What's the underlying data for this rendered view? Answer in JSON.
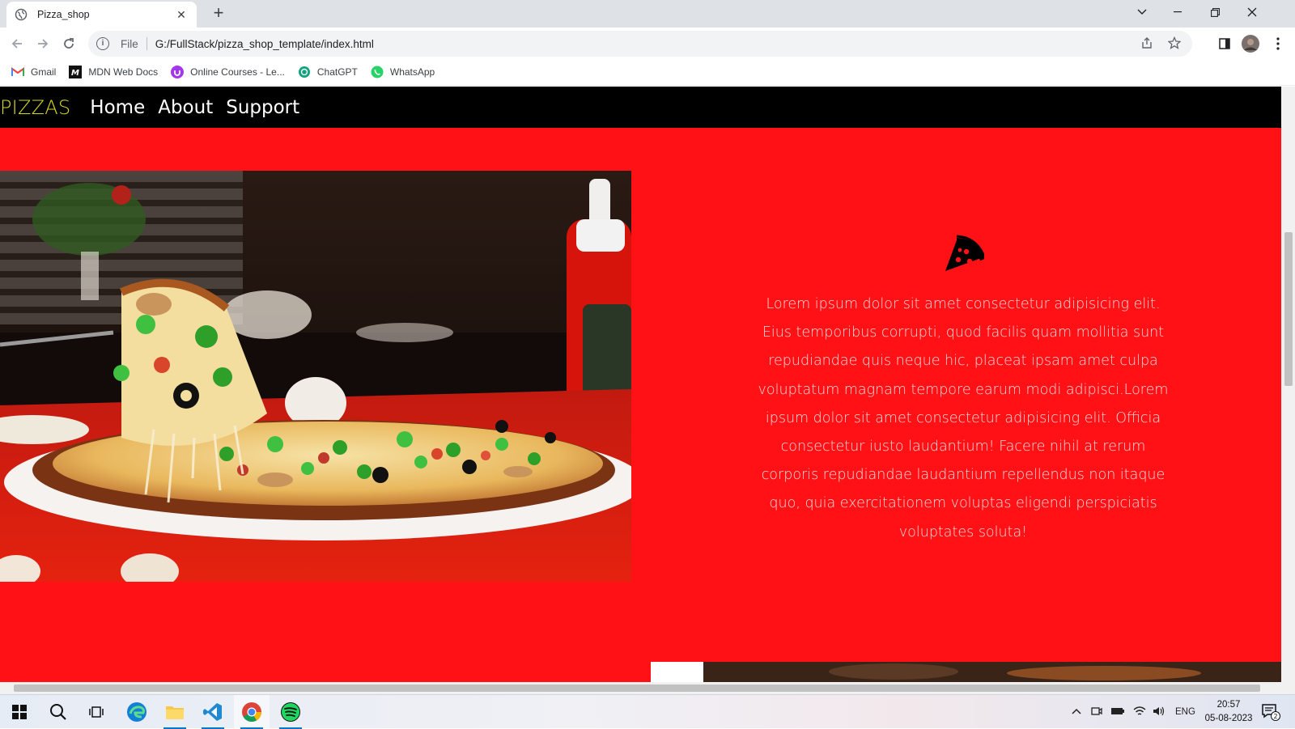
{
  "browser": {
    "tab_title": "Pizza_shop",
    "new_tab_label": "+",
    "address_scheme": "File",
    "address_url": "G:/FullStack/pizza_shop_template/index.html",
    "bookmarks": [
      {
        "label": "Gmail",
        "icon": "gmail-icon"
      },
      {
        "label": "MDN Web Docs",
        "icon": "mdn-icon"
      },
      {
        "label": "Online Courses - Le...",
        "icon": "udemy-icon"
      },
      {
        "label": "ChatGPT",
        "icon": "chatgpt-icon"
      },
      {
        "label": "WhatsApp",
        "icon": "whatsapp-icon"
      }
    ]
  },
  "site": {
    "brand": "PIZZAS",
    "nav": [
      "Home",
      "About",
      "Support"
    ],
    "body_text": "Lorem ipsum dolor sit amet consectetur adipisicing elit. Eius temporibus corrupti, quod facilis quam mollitia sunt repudiandae quis neque hic, placeat ipsam amet culpa voluptatum magnam tempore earum modi adipisci.Lorem ipsum dolor sit amet consectetur adipisicing elit. Officia consectetur iusto laudantium! Facere nihil at rerum corporis repudiandae laudantium repellendus non itaque quo, quia exercitationem voluptas eligendi perspiciatis voluptates soluta!",
    "colors": {
      "background": "#ff1115",
      "nav_bg": "#000000",
      "brand": "#d7d91f"
    }
  },
  "taskbar": {
    "language": "ENG",
    "time": "20:57",
    "date": "05-08-2023",
    "notification_count": "2",
    "apps": [
      "start-icon",
      "search-icon",
      "task-view-icon",
      "edge-icon",
      "file-explorer-icon",
      "vscode-icon",
      "chrome-icon",
      "spotify-icon"
    ]
  }
}
